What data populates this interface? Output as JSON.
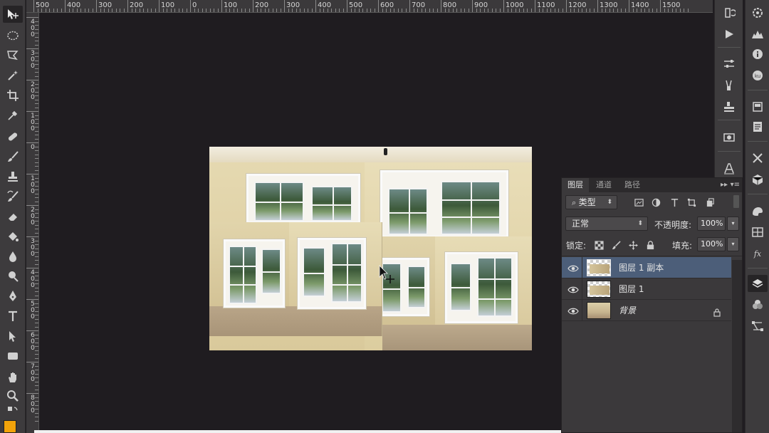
{
  "rulers": {
    "top_labels": [
      "500",
      "400",
      "300",
      "200",
      "100",
      "0",
      "100",
      "200",
      "300",
      "400",
      "500",
      "600",
      "700",
      "800",
      "900",
      "1000",
      "1100",
      "1200",
      "1300",
      "1400",
      "1500"
    ],
    "left_labels": [
      [
        "4",
        "0",
        "0"
      ],
      [
        "3",
        "0",
        "0"
      ],
      [
        "2",
        "0",
        "0"
      ],
      [
        "1",
        "0",
        "0"
      ],
      [
        "0"
      ],
      [
        "1",
        "0",
        "0"
      ],
      [
        "2",
        "0",
        "0"
      ],
      [
        "3",
        "0",
        "0"
      ],
      [
        "4",
        "0",
        "0"
      ],
      [
        "5",
        "0",
        "0"
      ],
      [
        "6",
        "0",
        "0"
      ],
      [
        "7",
        "0",
        "0"
      ],
      [
        "8",
        "0",
        "0"
      ]
    ]
  },
  "toolbar": {
    "tools": [
      "move-tool",
      "elliptical-marquee-tool",
      "polygonal-lasso-tool",
      "magic-wand-tool",
      "crop-tool",
      "eyedropper-tool",
      "healing-brush-tool",
      "brush-tool",
      "clone-stamp-tool",
      "history-brush-tool",
      "eraser-tool",
      "paint-bucket-tool",
      "blur-tool",
      "dodge-tool",
      "pen-tool",
      "type-tool",
      "path-selection-tool",
      "rectangle-tool",
      "hand-tool",
      "zoom-tool"
    ],
    "foreground_color": "#f2a30a"
  },
  "layers_panel": {
    "tabs": [
      "图层",
      "通道",
      "路径"
    ],
    "active_tab": "图层",
    "filter_label": "类型",
    "blend_mode": "正常",
    "opacity_label": "不透明度:",
    "opacity_value": "100%",
    "lock_label": "锁定:",
    "fill_label": "填充:",
    "fill_value": "100%",
    "layers": [
      {
        "name": "图层 1 副本",
        "selected": true,
        "visible": true,
        "locked": false,
        "kind": "transparent"
      },
      {
        "name": "图层 1",
        "selected": false,
        "visible": true,
        "locked": false,
        "kind": "transparent"
      },
      {
        "name": "背景",
        "selected": false,
        "visible": true,
        "locked": true,
        "kind": "background"
      }
    ]
  },
  "right_strip_icons": [
    "history-icon",
    "play-action-icon",
    "adjustments-icon",
    "brush-presets-icon",
    "clone-source-icon",
    "tool-presets-icon",
    "3d-icon",
    "character-icon"
  ],
  "far_right_icons": [
    "color-wheel-icon",
    "histogram-icon",
    "info-icon",
    "kuler-icon",
    "navigator-icon",
    "notes-icon",
    "tools-icon",
    "3d-cube-icon",
    "swatches-icon",
    "grid-icon",
    "fx-icon",
    "layers-icon",
    "channels-icon",
    "paths-icon"
  ]
}
